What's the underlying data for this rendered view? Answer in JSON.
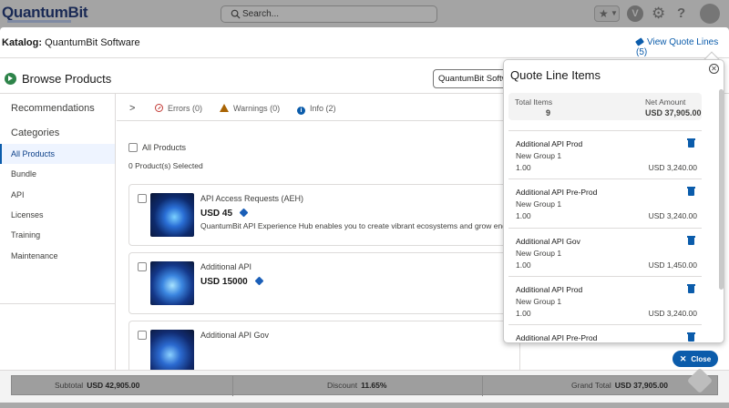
{
  "header": {
    "logo_text": "QuantumBit",
    "search_placeholder": "Search..."
  },
  "modal": {
    "catalog_label": "Katalog:",
    "catalog_name": "QuantumBit Software",
    "view_quote_lines": "View Quote Lines (5)",
    "page_title": "Browse Products",
    "catalog_select_value": "QuantumBit Software",
    "close_label": "Close"
  },
  "sidebar": {
    "recommendations": "Recommendations",
    "categories_heading": "Categories",
    "items": [
      {
        "label": "All Products"
      },
      {
        "label": "Bundle"
      },
      {
        "label": "API"
      },
      {
        "label": "Licenses"
      },
      {
        "label": "Training"
      },
      {
        "label": "Maintenance"
      }
    ]
  },
  "messages": {
    "errors": "Errors (0)",
    "warnings": "Warnings (0)",
    "info": "Info (2)"
  },
  "products": {
    "all_products_label": "All Products",
    "selected_count": "0 Product(s) Selected",
    "items": [
      {
        "name": "API Access Requests (AEH)",
        "price": "USD 45",
        "description": "QuantumBit API Experience Hub enables you to create vibrant ecosystems and grow engageme..."
      },
      {
        "name": "Additional API",
        "price": "USD 15000",
        "description": ""
      },
      {
        "name": "Additional API Gov",
        "price": "",
        "description": ""
      }
    ]
  },
  "quote_panel": {
    "title": "Quote Line Items",
    "total_items_label": "Total Items",
    "total_items_value": "9",
    "net_amount_label": "Net Amount",
    "net_amount_value": "USD 37,905.00",
    "items": [
      {
        "name": "Additional API Prod",
        "group": "New Group 1",
        "qty": "1.00",
        "amount": "USD 3,240.00"
      },
      {
        "name": "Additional API Pre-Prod",
        "group": "New Group 1",
        "qty": "1.00",
        "amount": "USD 3,240.00"
      },
      {
        "name": "Additional API Gov",
        "group": "New Group 1",
        "qty": "1.00",
        "amount": "USD 1,450.00"
      },
      {
        "name": "Additional API Prod",
        "group": "New Group 1",
        "qty": "1.00",
        "amount": "USD 3,240.00"
      },
      {
        "name": "Additional API Pre-Prod",
        "group": "",
        "qty": "",
        "amount": ""
      }
    ]
  },
  "totals": {
    "subtotal_label": "Subtotal",
    "subtotal_value": "USD 42,905.00",
    "discount_label": "Discount",
    "discount_value": "11.65%",
    "grand_total_label": "Grand Total",
    "grand_total_value": "USD 37,905.00"
  },
  "colors": {
    "accent": "#0b5cab",
    "success": "#2e844a",
    "error": "#c23934",
    "warning": "#a96404"
  }
}
